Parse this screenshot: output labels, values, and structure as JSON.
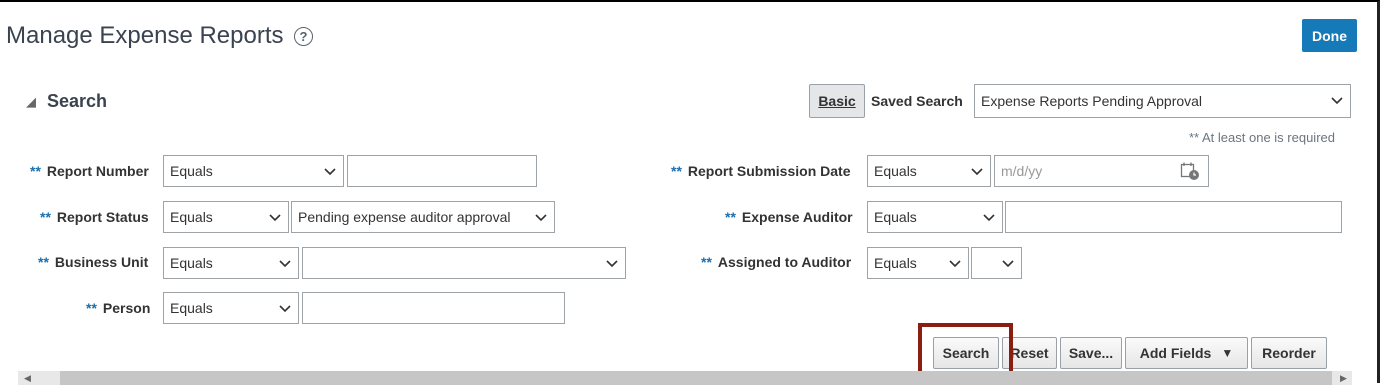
{
  "page": {
    "title": "Manage Expense Reports",
    "help_glyph": "?",
    "done_label": "Done"
  },
  "search": {
    "heading": "Search",
    "basic_label": "Basic",
    "saved_search_label": "Saved Search",
    "saved_search_value": "Expense Reports Pending Approval",
    "required_note": "** At least one is required",
    "req_marker": "**"
  },
  "fields": {
    "report_number": {
      "label": "Report Number",
      "operator": "Equals",
      "value": ""
    },
    "report_status": {
      "label": "Report Status",
      "operator": "Equals",
      "value": "Pending expense auditor approval"
    },
    "business_unit": {
      "label": "Business Unit",
      "operator": "Equals",
      "value": ""
    },
    "person": {
      "label": "Person",
      "operator": "Equals",
      "value": ""
    },
    "submission_date": {
      "label": "Report Submission Date",
      "operator": "Equals",
      "placeholder": "m/d/yy"
    },
    "expense_auditor": {
      "label": "Expense Auditor",
      "operator": "Equals",
      "value": ""
    },
    "assigned_to_auditor": {
      "label": "Assigned to Auditor",
      "operator": "Equals",
      "value": ""
    }
  },
  "actions": {
    "search": "Search",
    "reset": "Reset",
    "save": "Save...",
    "add_fields": "Add Fields",
    "add_fields_arrow": "▼",
    "reorder": "Reorder"
  },
  "icons": {
    "help": "help-circle-icon",
    "calendar": "calendar-icon",
    "chevron": "chevron-down-icon",
    "collapse": "triangle-collapse-icon"
  },
  "colors": {
    "accent": "#1679b8",
    "highlight": "#8b1e12",
    "required": "#1a6fae"
  }
}
